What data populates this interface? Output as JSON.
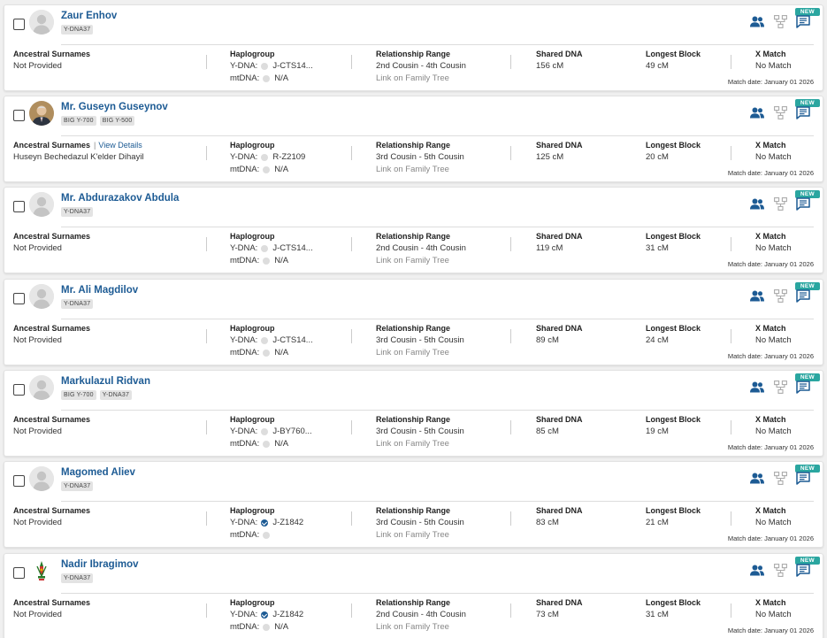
{
  "ui": {
    "new_label": "NEW",
    "labels": {
      "ancestral": "Ancestral Surnames",
      "haplogroup": "Haplogroup",
      "ydna": "Y-DNA:",
      "mtdna": "mtDNA:",
      "relationship": "Relationship Range",
      "link_tree": "Link on Family Tree",
      "shared": "Shared DNA",
      "longest": "Longest Block",
      "xmatch": "X Match",
      "view_details": "View Details",
      "match_date_prefix": "Match date: "
    },
    "colors": {
      "link": "#1d5b94",
      "new_badge": "#2aa6a0",
      "verified": "#1d5b94"
    }
  },
  "matches": [
    {
      "name": "Zaur Enhov",
      "avatar": "silhouette-icon",
      "badges": [
        "Y-DNA37"
      ],
      "ancestral": "Not Provided",
      "view_details": false,
      "ydna": "J-CTS14...",
      "ydna_verified": false,
      "mtdna": "N/A",
      "relationship": "2nd Cousin - 4th Cousin",
      "shared": "156 cM",
      "longest": "49 cM",
      "xmatch": "No Match",
      "match_date": "January 01 2026"
    },
    {
      "name": "Mr. Guseyn Guseynov",
      "avatar": "photo-portrait",
      "badges": [
        "BIG Y-700",
        "BIG Y-500"
      ],
      "ancestral": "Huseyn Bechedazul K'elder Dihayil",
      "view_details": true,
      "ydna": "R-Z2109",
      "ydna_verified": false,
      "mtdna": "N/A",
      "relationship": "3rd Cousin - 5th Cousin",
      "shared": "125 cM",
      "longest": "20 cM",
      "xmatch": "No Match",
      "match_date": "January 01 2026"
    },
    {
      "name": "Mr. Abdurazakov Abdula",
      "avatar": "silhouette-icon",
      "badges": [
        "Y-DNA37"
      ],
      "ancestral": "Not Provided",
      "view_details": false,
      "ydna": "J-CTS14...",
      "ydna_verified": false,
      "mtdna": "N/A",
      "relationship": "2nd Cousin - 4th Cousin",
      "shared": "119 cM",
      "longest": "31 cM",
      "xmatch": "No Match",
      "match_date": "January 01 2026"
    },
    {
      "name": "Mr. Ali Magdilov",
      "avatar": "silhouette-icon",
      "badges": [
        "Y-DNA37"
      ],
      "ancestral": "Not Provided",
      "view_details": false,
      "ydna": "J-CTS14...",
      "ydna_verified": false,
      "mtdna": "N/A",
      "relationship": "3rd Cousin - 5th Cousin",
      "shared": "89 cM",
      "longest": "24 cM",
      "xmatch": "No Match",
      "match_date": "January 01 2026"
    },
    {
      "name": "Markulazul Ridvan",
      "avatar": "silhouette-icon",
      "badges": [
        "BIG Y-700",
        "Y-DNA37"
      ],
      "ancestral": "Not Provided",
      "view_details": false,
      "ydna": "J-BY760...",
      "ydna_verified": false,
      "mtdna": "N/A",
      "relationship": "3rd Cousin - 5th Cousin",
      "shared": "85 cM",
      "longest": "19 cM",
      "xmatch": "No Match",
      "match_date": "January 01 2026"
    },
    {
      "name": "Magomed Aliev",
      "avatar": "silhouette-icon",
      "badges": [
        "Y-DNA37"
      ],
      "ancestral": "Not Provided",
      "view_details": false,
      "ydna": "J-Z1842",
      "ydna_verified": true,
      "mtdna": "",
      "relationship": "3rd Cousin - 5th Cousin",
      "shared": "83 cM",
      "longest": "21 cM",
      "xmatch": "No Match",
      "match_date": "January 01 2026"
    },
    {
      "name": "Nadir Ibragimov",
      "avatar": "emblem-icon",
      "badges": [
        "Y-DNA37"
      ],
      "ancestral": "Not Provided",
      "view_details": false,
      "ydna": "J-Z1842",
      "ydna_verified": true,
      "mtdna": "N/A",
      "relationship": "2nd Cousin - 4th Cousin",
      "shared": "73 cM",
      "longest": "31 cM",
      "xmatch": "No Match",
      "match_date": "January 01 2026"
    }
  ]
}
